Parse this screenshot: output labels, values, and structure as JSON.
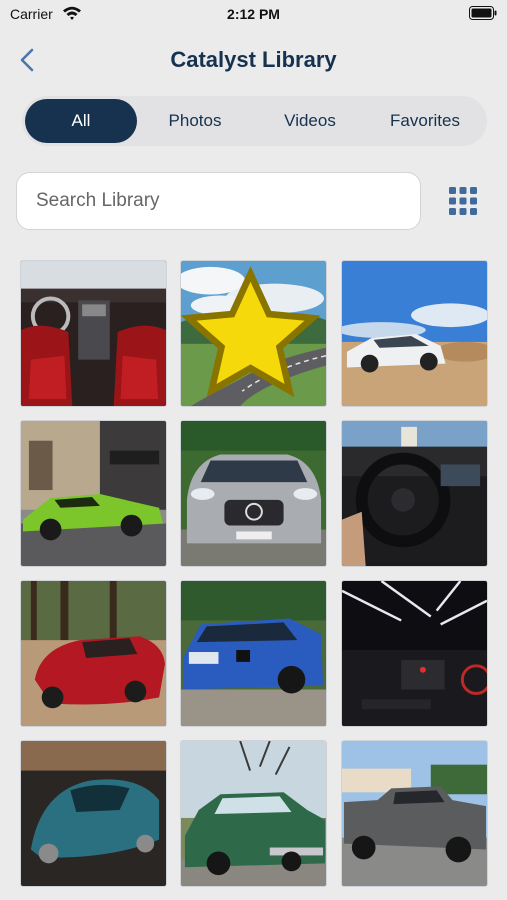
{
  "status_bar": {
    "carrier": "Carrier",
    "time": "2:12 PM"
  },
  "nav": {
    "title": "Catalyst Library"
  },
  "tabs": [
    {
      "label": "All",
      "active": true
    },
    {
      "label": "Photos",
      "active": false
    },
    {
      "label": "Videos",
      "active": false
    },
    {
      "label": "Favorites",
      "active": false
    }
  ],
  "search": {
    "placeholder": "Search Library"
  },
  "colors": {
    "accent": "#16324f",
    "background": "#ebebec",
    "favorite": "#f5d90a"
  },
  "gallery": {
    "items": [
      {
        "subject": "red car interior",
        "favorite": false
      },
      {
        "subject": "road through hills",
        "favorite": true
      },
      {
        "subject": "white sedan on dirt",
        "favorite": false
      },
      {
        "subject": "green sports car",
        "favorite": false
      },
      {
        "subject": "silver AMG front",
        "favorite": false
      },
      {
        "subject": "steering wheel interior",
        "favorite": false
      },
      {
        "subject": "red sports car",
        "favorite": false
      },
      {
        "subject": "blue sedan",
        "favorite": false
      },
      {
        "subject": "night dashboard",
        "favorite": false
      },
      {
        "subject": "teal concept car",
        "favorite": false
      },
      {
        "subject": "green classic car",
        "favorite": false
      },
      {
        "subject": "grey pickup truck",
        "favorite": false
      }
    ]
  }
}
